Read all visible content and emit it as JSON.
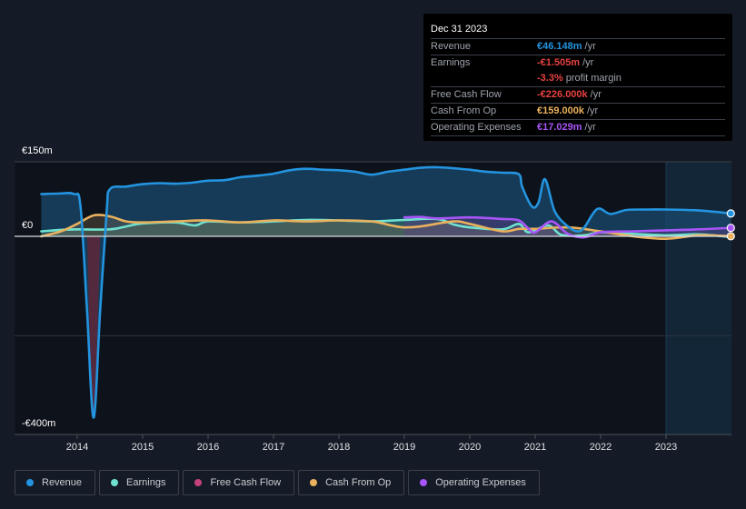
{
  "tooltip": {
    "date": "Dec 31 2023",
    "rows": [
      {
        "label": "Revenue",
        "value": "€46.148m",
        "unit": "/yr",
        "color": "#2394df"
      },
      {
        "label": "Earnings",
        "value": "-€1.505m",
        "unit": "/yr",
        "color": "#e64141"
      },
      {
        "label": "",
        "value": "-3.3%",
        "unit": "profit margin",
        "color": "#e64141"
      },
      {
        "label": "Free Cash Flow",
        "value": "-€226.000k",
        "unit": "/yr",
        "color": "#e64141"
      },
      {
        "label": "Cash From Op",
        "value": "€159.000k",
        "unit": "/yr",
        "color": "#e9b15d"
      },
      {
        "label": "Operating Expenses",
        "value": "€17.029m",
        "unit": "/yr",
        "color": "#a855f7"
      }
    ]
  },
  "legend": [
    {
      "label": "Revenue",
      "color": "#2394df"
    },
    {
      "label": "Earnings",
      "color": "#6ee1cf"
    },
    {
      "label": "Free Cash Flow",
      "color": "#c4427a"
    },
    {
      "label": "Cash From Op",
      "color": "#e9b15d"
    },
    {
      "label": "Operating Expenses",
      "color": "#a855f7"
    }
  ],
  "chart_data": {
    "type": "area",
    "title": "",
    "xlabel": "",
    "ylabel": "",
    "y_tick_labels": [
      "€150m",
      "€0",
      "-€400m"
    ],
    "y_ticks": [
      150,
      0,
      -400
    ],
    "ylim": [
      -400,
      150
    ],
    "xlim": [
      2013.0,
      2024.0
    ],
    "x_tick_labels": [
      "2014",
      "2015",
      "2016",
      "2017",
      "2018",
      "2019",
      "2020",
      "2021",
      "2022",
      "2023"
    ],
    "x_ticks": [
      2014,
      2015,
      2016,
      2017,
      2018,
      2019,
      2020,
      2021,
      2022,
      2023
    ],
    "forecast_shade_start": 2023.0,
    "grid": true,
    "legend_position": "bottom",
    "series": [
      {
        "name": "Revenue",
        "color": "#2394df",
        "points": [
          [
            2013.45,
            85
          ],
          [
            2013.7,
            86
          ],
          [
            2013.95,
            85
          ],
          [
            2014.05,
            60
          ],
          [
            2014.15,
            -150
          ],
          [
            2014.25,
            -365
          ],
          [
            2014.35,
            -150
          ],
          [
            2014.45,
            50
          ],
          [
            2014.5,
            95
          ],
          [
            2014.75,
            100
          ],
          [
            2015.0,
            105
          ],
          [
            2015.25,
            107
          ],
          [
            2015.5,
            106
          ],
          [
            2015.75,
            108
          ],
          [
            2016.0,
            112
          ],
          [
            2016.25,
            113
          ],
          [
            2016.5,
            119
          ],
          [
            2016.75,
            122
          ],
          [
            2017.0,
            126
          ],
          [
            2017.25,
            133
          ],
          [
            2017.5,
            136
          ],
          [
            2017.75,
            134
          ],
          [
            2018.0,
            133
          ],
          [
            2018.25,
            130
          ],
          [
            2018.5,
            124
          ],
          [
            2018.75,
            130
          ],
          [
            2019.0,
            134
          ],
          [
            2019.25,
            138
          ],
          [
            2019.5,
            139
          ],
          [
            2019.75,
            137
          ],
          [
            2020.0,
            134
          ],
          [
            2020.25,
            130
          ],
          [
            2020.5,
            128
          ],
          [
            2020.75,
            125
          ],
          [
            2020.8,
            100
          ],
          [
            2020.95,
            60
          ],
          [
            2021.05,
            68
          ],
          [
            2021.15,
            115
          ],
          [
            2021.3,
            50
          ],
          [
            2021.5,
            20
          ],
          [
            2021.65,
            10
          ],
          [
            2021.75,
            18
          ],
          [
            2021.95,
            55
          ],
          [
            2022.15,
            45
          ],
          [
            2022.4,
            53
          ],
          [
            2022.75,
            54
          ],
          [
            2023.0,
            54
          ],
          [
            2023.5,
            52
          ],
          [
            2023.99,
            46
          ]
        ]
      },
      {
        "name": "Earnings",
        "color": "#6ee1cf",
        "points": [
          [
            2013.45,
            10
          ],
          [
            2013.75,
            13
          ],
          [
            2014.0,
            14
          ],
          [
            2014.5,
            14
          ],
          [
            2014.75,
            20
          ],
          [
            2015.0,
            26
          ],
          [
            2015.5,
            28
          ],
          [
            2015.8,
            22
          ],
          [
            2016.0,
            30
          ],
          [
            2016.5,
            28
          ],
          [
            2017.0,
            30
          ],
          [
            2017.5,
            33
          ],
          [
            2018.0,
            32
          ],
          [
            2018.5,
            30
          ],
          [
            2019.0,
            33
          ],
          [
            2019.5,
            35
          ],
          [
            2019.75,
            24
          ],
          [
            2020.0,
            18
          ],
          [
            2020.5,
            14
          ],
          [
            2020.75,
            25
          ],
          [
            2020.9,
            8
          ],
          [
            2021.2,
            22
          ],
          [
            2021.4,
            3
          ],
          [
            2021.75,
            2
          ],
          [
            2022.0,
            8
          ],
          [
            2022.5,
            5
          ],
          [
            2023.0,
            2
          ],
          [
            2023.5,
            4
          ],
          [
            2023.99,
            -1.5
          ]
        ]
      },
      {
        "name": "Free Cash Flow",
        "color": "#c4427a",
        "points": [
          [
            2014.15,
            0
          ],
          [
            2014.25,
            -365
          ],
          [
            2014.35,
            0
          ]
        ]
      },
      {
        "name": "Cash From Op",
        "color": "#e9b15d",
        "points": [
          [
            2013.45,
            0
          ],
          [
            2013.75,
            10
          ],
          [
            2014.0,
            25
          ],
          [
            2014.25,
            42
          ],
          [
            2014.5,
            40
          ],
          [
            2014.75,
            30
          ],
          [
            2015.0,
            28
          ],
          [
            2015.5,
            30
          ],
          [
            2016.0,
            32
          ],
          [
            2016.5,
            28
          ],
          [
            2017.0,
            32
          ],
          [
            2017.5,
            30
          ],
          [
            2018.0,
            32
          ],
          [
            2018.5,
            30
          ],
          [
            2018.8,
            22
          ],
          [
            2019.0,
            18
          ],
          [
            2019.25,
            20
          ],
          [
            2019.75,
            30
          ],
          [
            2020.0,
            25
          ],
          [
            2020.5,
            10
          ],
          [
            2020.75,
            15
          ],
          [
            2021.0,
            15
          ],
          [
            2021.5,
            18
          ],
          [
            2022.0,
            10
          ],
          [
            2022.5,
            0
          ],
          [
            2023.0,
            -5
          ],
          [
            2023.5,
            2
          ],
          [
            2023.99,
            0.16
          ]
        ]
      },
      {
        "name": "Operating Expenses",
        "color": "#a855f7",
        "points": [
          [
            2019.0,
            38
          ],
          [
            2019.25,
            39
          ],
          [
            2019.5,
            36
          ],
          [
            2020.0,
            38
          ],
          [
            2020.5,
            35
          ],
          [
            2020.75,
            32
          ],
          [
            2020.9,
            15
          ],
          [
            2021.0,
            8
          ],
          [
            2021.25,
            30
          ],
          [
            2021.5,
            5
          ],
          [
            2021.75,
            -2
          ],
          [
            2022.0,
            8
          ],
          [
            2022.5,
            10
          ],
          [
            2023.0,
            12
          ],
          [
            2023.5,
            14
          ],
          [
            2023.99,
            17
          ]
        ]
      }
    ]
  }
}
